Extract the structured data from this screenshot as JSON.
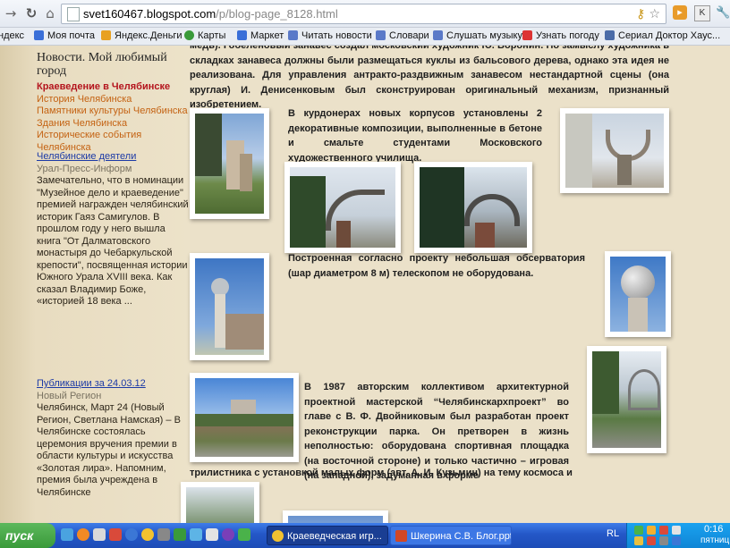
{
  "browser": {
    "url_host": "svet160467.blogspot.com",
    "url_path": "/p/blog-page_8128.html",
    "back_icon": "→",
    "reload_icon": "C",
    "home_icon": "home"
  },
  "bookmarks": [
    {
      "label": "ндекс",
      "color": "#d33"
    },
    {
      "label": "Моя почта",
      "color": "#3a6fd8"
    },
    {
      "label": "Яндекс.Деньги",
      "color": "#e8a020"
    },
    {
      "label": "Карты",
      "color": "#3a9a3a"
    },
    {
      "label": "Маркет",
      "color": "#3a6fd8"
    },
    {
      "label": "Читать новости",
      "color": "#5a79c8"
    },
    {
      "label": "Словари",
      "color": "#5a79c8"
    },
    {
      "label": "Слушать музыку",
      "color": "#5a79c8"
    },
    {
      "label": "Узнать погоду",
      "color": "#d33"
    },
    {
      "label": "Сериал Доктор Хаус...",
      "color": "#4b6ca8"
    }
  ],
  "sidebar": {
    "title": "Новости. Мой любимый город",
    "local_history": "Краеведение в Челябинске",
    "links": [
      "История Челябинска",
      "Памятники культуры Челябинска",
      "Здания Челябинска",
      "Исторические события Челябинска"
    ],
    "figures_link": "Челябинские деятели",
    "figures_source": "Урал-Пресс-Информ",
    "figures_text": "Замечательно, что в номинации \"Музейное дело и краеведение\" премией награжден челябинский историк Гаяз Самигулов. В прошлом году у него вышла книга \"От Далматовского монастыря до Чебаркульской крепости\", посвященная истории Южного Урала XVIII века. Как сказал Владимир Боже, «историей 18 века ...",
    "pub_link": "Публикации за 24.03.12",
    "pub_source": "Новый Регион",
    "pub_text": "Челябинск, Март 24 (Новый Регион, Светлана Намская) – В Челябинске состоялась церемония вручения премии в области культуры и искусства «Золотая лира». Напомним, премия была учреждена в Челябинске"
  },
  "content": {
    "p1": "медь). Гобеленовый занавес создал московский художник Ю. Воронин. По замыслу художника в складках занавеса должны были размещаться куклы из бальсового дерева, однако эта идея не реализована. Для управления антракто-раздвижным занавесом нестандартной сцены (она круглая) И. Денисенковым был сконструирован оригинальный механизм, признанный изобретением.",
    "p2": "В курдонерах новых корпусов установлены 2 декоративные композиции, выполненные в бетоне и смальте студентами Московского художественного училища.",
    "p3": "Построенная согласно проекту небольшая обсерватория (шар диаметром 8 м) телескопом не оборудована.",
    "p4a": "В 1987 авторским коллективом архитектурной проектной мастерской “Челябинскархпроект” во главе с В. Ф. Двойниковым был разработан проект реконструкции парка. Он претворен в жизнь неполностью: оборудована спортивная площадка (на восточной стороне) и только частично – игровая (на западной), задуманная в форме",
    "p4b": "трилистника с установкой  малых форм (авт. А. И. Кузьмин) на тему космоса и"
  },
  "taskbar": {
    "start_label": "пуск",
    "tasks": [
      "Краеведческая игр...",
      "Шкерина С.В. Блог.ppt"
    ],
    "lang": "RL",
    "time": "0:16",
    "day": "пятниц"
  }
}
